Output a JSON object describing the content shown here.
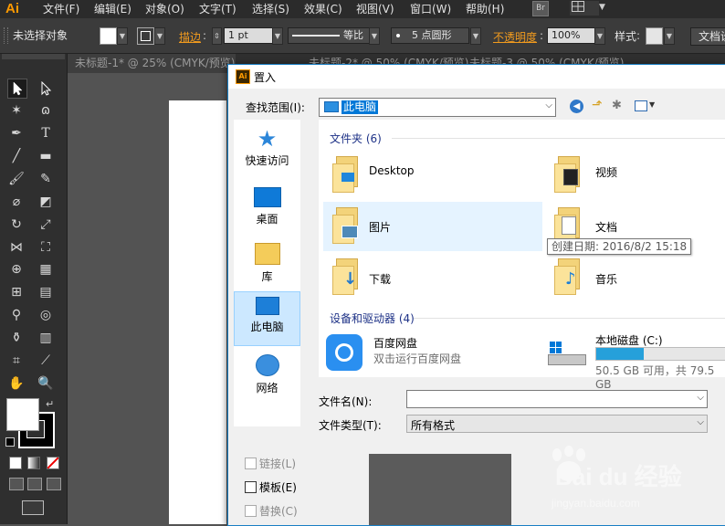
{
  "app": {
    "logo": "Ai",
    "menu": [
      "文件(F)",
      "编辑(E)",
      "对象(O)",
      "文字(T)",
      "选择(S)",
      "效果(C)",
      "视图(V)",
      "窗口(W)",
      "帮助(H)"
    ],
    "bridge_label": "Br"
  },
  "control_bar": {
    "selection_status": "未选择对象",
    "stroke_label": "描边",
    "stroke_weight": "1 pt",
    "stroke_profile": "等比",
    "brush": "5 点圆形",
    "opacity_label": "不透明度",
    "opacity_value": "100%",
    "style_label": "样式",
    "doc_settings": "文档设"
  },
  "tabs": [
    "未标题-1* @ 25% (CMYK/预览)",
    "未标题-2* @ 50% (CMYK/预览)",
    "未标题-3 @ 50% (CMYK/预览)"
  ],
  "dialog": {
    "title": "置入",
    "look_in_label": "查找范围(I):",
    "look_in_value": "此电脑",
    "sidebar": [
      {
        "label": "快速访问",
        "icon": "star-icon"
      },
      {
        "label": "桌面",
        "icon": "desktop-icon"
      },
      {
        "label": "库",
        "icon": "library-icon"
      },
      {
        "label": "此电脑",
        "icon": "computer-icon",
        "selected": true
      },
      {
        "label": "网络",
        "icon": "network-icon"
      }
    ],
    "folders_header": "文件夹 (6)",
    "folders": [
      {
        "name": "Desktop",
        "icon": "desktop-folder-icon"
      },
      {
        "name": "视频",
        "icon": "video-folder-icon"
      },
      {
        "name": "图片",
        "icon": "pictures-folder-icon",
        "highlighted": true
      },
      {
        "name": "文档",
        "icon": "documents-folder-icon"
      },
      {
        "name": "下载",
        "icon": "downloads-folder-icon"
      },
      {
        "name": "音乐",
        "icon": "music-folder-icon"
      }
    ],
    "tooltip": "创建日期: 2016/8/2 15:18",
    "devices_header": "设备和驱动器 (4)",
    "devices": [
      {
        "name": "百度网盘",
        "sub": "双击运行百度网盘",
        "icon": "baidu-netdisk-icon"
      },
      {
        "name": "本地磁盘 (C:)",
        "sub": "50.5 GB 可用，共 79.5 GB",
        "icon": "local-disk-icon",
        "usage_fraction": 0.365
      }
    ],
    "filename_label": "文件名(N):",
    "filename_value": "",
    "filetype_label": "文件类型(T):",
    "filetype_value": "所有格式",
    "options": [
      {
        "label": "链接(L)",
        "enabled": false,
        "checked": false
      },
      {
        "label": "模板(E)",
        "enabled": true,
        "checked": false
      },
      {
        "label": "替换(C)",
        "enabled": false,
        "checked": false
      }
    ]
  },
  "watermark": {
    "brand": "Bai du 经验",
    "url": "jingyan.baidu.com"
  }
}
